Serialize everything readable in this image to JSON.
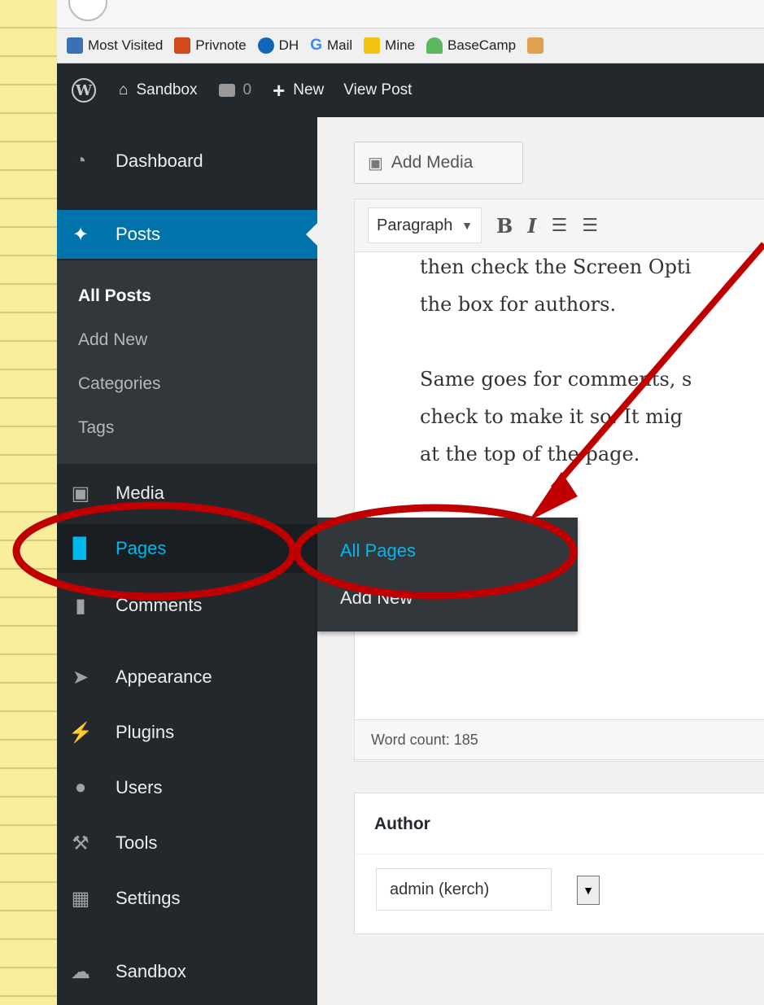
{
  "browser": {
    "bookmarks": [
      {
        "label": "Most Visited",
        "icon": "most-visited-icon",
        "color": "#3b6fb6"
      },
      {
        "label": "Privnote",
        "icon": "privnote-lock-icon",
        "color": "#d24a1c"
      },
      {
        "label": "DH",
        "icon": "dh-moon-icon",
        "color": "#1166bb"
      },
      {
        "label": "Mail",
        "icon": "google-g-icon",
        "color": "#4285f4"
      },
      {
        "label": "Mine",
        "icon": "folder-icon",
        "color": "#f1c40f"
      },
      {
        "label": "BaseCamp",
        "icon": "basecamp-mountain-icon",
        "color": "#5cb85c"
      }
    ]
  },
  "adminbar": {
    "site_name": "Sandbox",
    "comment_count": "0",
    "new_label": "New",
    "view_post_label": "View Post"
  },
  "sidebar": {
    "items": [
      {
        "label": "Dashboard",
        "icon": "dashboard-icon"
      },
      {
        "label": "Posts",
        "icon": "pushpin-icon"
      },
      {
        "label": "Media",
        "icon": "media-icon"
      },
      {
        "label": "Pages",
        "icon": "pages-icon"
      },
      {
        "label": "Comments",
        "icon": "comment-icon"
      },
      {
        "label": "Appearance",
        "icon": "paintbrush-icon"
      },
      {
        "label": "Plugins",
        "icon": "plug-icon"
      },
      {
        "label": "Users",
        "icon": "user-icon"
      },
      {
        "label": "Tools",
        "icon": "wrench-icon"
      },
      {
        "label": "Settings",
        "icon": "settings-icon"
      },
      {
        "label": "Sandbox",
        "icon": "cloud-icon"
      }
    ],
    "posts_submenu": [
      "All Posts",
      "Add New",
      "Categories",
      "Tags"
    ],
    "pages_flyout": [
      "All Pages",
      "Add New"
    ]
  },
  "editor": {
    "add_media_label": "Add Media",
    "format_value": "Paragraph",
    "lines": [
      "then check the Screen Opti",
      "the box for authors.",
      "Same goes for comments, s",
      "check to make it so. It mig",
      "at the top of the page."
    ],
    "word_count": "Word count: 185"
  },
  "author_box": {
    "title": "Author",
    "selected": "admin (kerch)"
  },
  "colors": {
    "accent": "#0073aa",
    "highlight": "#00b9eb",
    "annotation": "#c00000",
    "sidebar_bg": "#23282d"
  }
}
